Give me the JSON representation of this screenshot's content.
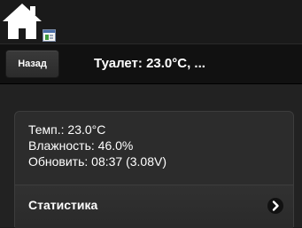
{
  "header": {
    "back_label": "Назад",
    "title": "Туалет: 23.0°C, ..."
  },
  "sensor": {
    "temperature": "Темп.: 23.0°C",
    "humidity": "Влажность: 46.0%",
    "updated": "Обновить: 08:37 (3.08V)"
  },
  "stats": {
    "label": "Статистика"
  },
  "icons": {
    "home": "home-icon",
    "badge": "app-badge-icon",
    "chevron": "chevron-right-icon"
  }
}
